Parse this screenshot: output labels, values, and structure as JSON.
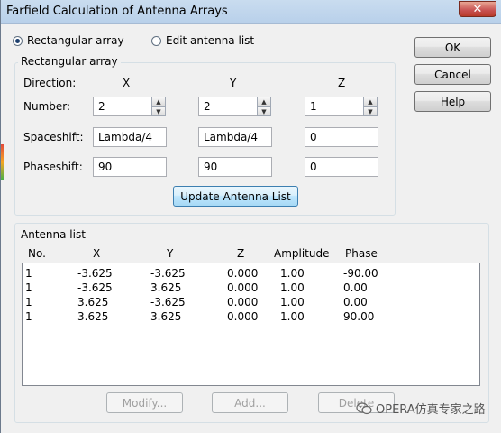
{
  "window": {
    "title": "Farfield Calculation of Antenna Arrays",
    "close_glyph": "✕"
  },
  "mode": {
    "rect_label": "Rectangular array",
    "rect_selected": true,
    "edit_label": "Edit antenna list",
    "edit_selected": false
  },
  "rect_group": {
    "title": "Rectangular array",
    "direction_label": "Direction:",
    "x_label": "X",
    "y_label": "Y",
    "z_label": "Z",
    "number_label": "Number:",
    "number": {
      "x": "2",
      "y": "2",
      "z": "1"
    },
    "spaceshift_label": "Spaceshift:",
    "spaceshift": {
      "x": "Lambda/4",
      "y": "Lambda/4",
      "z": "0"
    },
    "phaseshift_label": "Phaseshift:",
    "phaseshift": {
      "x": "90",
      "y": "90",
      "z": "0"
    },
    "update_button": "Update Antenna List"
  },
  "buttons": {
    "ok": "OK",
    "cancel": "Cancel",
    "help": "Help"
  },
  "antenna_list": {
    "title": "Antenna list",
    "columns": [
      "No.",
      "X",
      "Y",
      "Z",
      "Amplitude",
      "Phase"
    ],
    "rows": [
      [
        "1",
        "-3.625",
        "-3.625",
        "0.000",
        "1.00",
        "-90.00"
      ],
      [
        "1",
        "-3.625",
        "3.625",
        "0.000",
        "1.00",
        "0.00"
      ],
      [
        "1",
        "3.625",
        "-3.625",
        "0.000",
        "1.00",
        "0.00"
      ],
      [
        "1",
        "3.625",
        "3.625",
        "0.000",
        "1.00",
        "90.00"
      ]
    ],
    "modify_button": "Modify...",
    "add_button": "Add...",
    "delete_button": "Delete"
  },
  "watermark": {
    "text": "OPERA仿真专家之路",
    "icon": "wechat-icon"
  }
}
